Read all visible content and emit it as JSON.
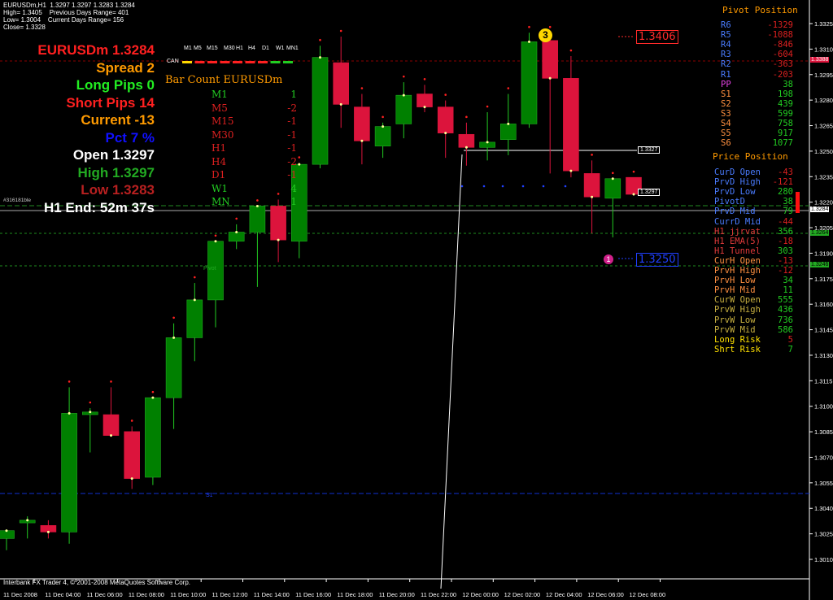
{
  "info": {
    "line1": "EURUSDm,H1  1.3297 1.3297 1.3283 1.3284",
    "line2": "High= 1.3405    Previous Days Range= 401",
    "line3": "Low= 1.3004    Current Days Range= 156",
    "line4": "Close= 1.3328"
  },
  "stats": [
    {
      "text": "EURUSDm 1.3284",
      "color": "#ff2020"
    },
    {
      "text": "Spread 2",
      "color": "#ff9a00"
    },
    {
      "text": "Long Pips 0",
      "color": "#22ee22"
    },
    {
      "text": "Short Pips 14",
      "color": "#ff2020"
    },
    {
      "text": "Current -13",
      "color": "#ff9a00"
    },
    {
      "text": "Pct 7 %",
      "color": "#1010ff"
    },
    {
      "text": "Open 1.3297",
      "color": "#ffffff"
    },
    {
      "text": "High 1.3297",
      "color": "#22aa22"
    },
    {
      "text": "Low 1.3283",
      "color": "#b82020"
    },
    {
      "text": "H1 End: 52m 37s",
      "color": "#ffffff"
    }
  ],
  "tf_header": [
    "M1",
    "M5",
    "M15",
    "M30",
    "H1",
    "H4",
    "D1",
    "W1",
    "MN1"
  ],
  "can_label": "CAN",
  "bar_count": {
    "title": "Bar Count EURUSDm",
    "rows": [
      {
        "tf": "M1",
        "val": "1",
        "color": "#22cc22"
      },
      {
        "tf": "M5",
        "val": "-2",
        "color": "#dd2020"
      },
      {
        "tf": "M15",
        "val": "-1",
        "color": "#dd2020"
      },
      {
        "tf": "M30",
        "val": "-1",
        "color": "#dd2020"
      },
      {
        "tf": "H1",
        "val": "-1",
        "color": "#dd2020"
      },
      {
        "tf": "H4",
        "val": "-2",
        "color": "#dd2020"
      },
      {
        "tf": "D1",
        "val": "-1",
        "color": "#dd2020"
      },
      {
        "tf": "W1",
        "val": "4",
        "color": "#22cc22"
      },
      {
        "tf": "MN",
        "val": "1",
        "color": "#22cc22"
      }
    ]
  },
  "pivot_position": {
    "title": "Pivot Position",
    "rows": [
      {
        "name": "R6",
        "val": "-1329",
        "nc": "#4a7cff",
        "vc": "#dd2020"
      },
      {
        "name": "R5",
        "val": "-1088",
        "nc": "#4a7cff",
        "vc": "#dd2020"
      },
      {
        "name": "R4",
        "val": "-846",
        "nc": "#4a7cff",
        "vc": "#dd2020"
      },
      {
        "name": "R3",
        "val": "-604",
        "nc": "#4a7cff",
        "vc": "#dd2020"
      },
      {
        "name": "R2",
        "val": "-363",
        "nc": "#4a7cff",
        "vc": "#dd2020"
      },
      {
        "name": "R1",
        "val": "-203",
        "nc": "#4a7cff",
        "vc": "#dd2020"
      },
      {
        "name": "PP",
        "val": "38",
        "nc": "#e040e0",
        "vc": "#22cc22"
      },
      {
        "name": "S1",
        "val": "198",
        "nc": "#ff9040",
        "vc": "#22cc22"
      },
      {
        "name": "S2",
        "val": "439",
        "nc": "#ff9040",
        "vc": "#22cc22"
      },
      {
        "name": "S3",
        "val": "599",
        "nc": "#ff9040",
        "vc": "#22cc22"
      },
      {
        "name": "S4",
        "val": "758",
        "nc": "#ff9040",
        "vc": "#22cc22"
      },
      {
        "name": "S5",
        "val": "917",
        "nc": "#ff9040",
        "vc": "#22cc22"
      },
      {
        "name": "S6",
        "val": "1077",
        "nc": "#ff9040",
        "vc": "#22cc22"
      }
    ]
  },
  "price_position": {
    "title": "Price Position",
    "rows": [
      {
        "name": "CurD Open",
        "val": "-43",
        "nc": "#4a7cff",
        "vc": "#dd2020"
      },
      {
        "name": "PrvD High",
        "val": "-121",
        "nc": "#4a7cff",
        "vc": "#dd2020"
      },
      {
        "name": "PrvD Low",
        "val": "280",
        "nc": "#4a7cff",
        "vc": "#22cc22"
      },
      {
        "name": "PivotD",
        "val": "38",
        "nc": "#4a7cff",
        "vc": "#22cc22"
      },
      {
        "name": "PrvD Mid",
        "val": "79",
        "nc": "#4a7cff",
        "vc": "#22cc22"
      },
      {
        "name": "CurrD Mid",
        "val": "-44",
        "nc": "#4a7cff",
        "vc": "#dd2020"
      },
      {
        "name": "H1 jjrvat",
        "val": "356",
        "nc": "#e03a3a",
        "vc": "#22cc22"
      },
      {
        "name": "H1 EMA(5)",
        "val": "-18",
        "nc": "#e03a3a",
        "vc": "#dd2020"
      },
      {
        "name": "H1 Tunnel",
        "val": "303",
        "nc": "#e03a3a",
        "vc": "#22cc22"
      },
      {
        "name": "CurH Open",
        "val": "-13",
        "nc": "#ff9040",
        "vc": "#dd2020"
      },
      {
        "name": "PrvH High",
        "val": "-12",
        "nc": "#ff9040",
        "vc": "#dd2020"
      },
      {
        "name": "PrvH Low",
        "val": "34",
        "nc": "#ff9040",
        "vc": "#22cc22"
      },
      {
        "name": "PrvH Mid",
        "val": "11",
        "nc": "#ff9040",
        "vc": "#22cc22"
      },
      {
        "name": "CurW Open",
        "val": "555",
        "nc": "#c8b040",
        "vc": "#22cc22"
      },
      {
        "name": "PrvW High",
        "val": "436",
        "nc": "#c8b040",
        "vc": "#22cc22"
      },
      {
        "name": "PrvW Low",
        "val": "736",
        "nc": "#c8b040",
        "vc": "#22cc22"
      },
      {
        "name": "PrvW Mid",
        "val": "586",
        "nc": "#c8b040",
        "vc": "#22cc22"
      },
      {
        "name": "Long Risk",
        "val": "5",
        "nc": "#ffe000",
        "vc": "#dd2020"
      },
      {
        "name": "Shrt Risk",
        "val": "7",
        "nc": "#ffe000",
        "vc": "#22cc22"
      }
    ]
  },
  "labels": {
    "level_high": "1.3406",
    "level_low": "1.3250",
    "marker_3": "3",
    "marker_1": "1",
    "tag_3327": "1.3327",
    "tag_3297": "1.3297",
    "pivot_text": "Pivot",
    "s1_text": "S1",
    "footer": "Interbank FX Trader 4, © 2001-2008 MetaQuotes Software Corp.",
    "left_axis_tag": "#316181ble",
    "price_box_current": "1.3284",
    "price_box_r": "1.3388",
    "price_box_g1": "1.3264",
    "price_box_g2": "1.3246"
  },
  "colors": {
    "bull": "#008000",
    "bear": "#dc143c",
    "up_wick": "#22cc22",
    "down_wick": "#dc143c"
  },
  "chart_data": {
    "type": "candlestick",
    "symbol": "EURUSDm",
    "timeframe": "H1",
    "ylim": [
      1.3004,
      1.3336
    ],
    "y_ticks": [
      "1.3325",
      "1.3310",
      "1.3295",
      "1.3280",
      "1.3265",
      "1.3250",
      "1.3235",
      "1.3220",
      "1.3205",
      "1.3190",
      "1.3175",
      "1.3160",
      "1.3145",
      "1.3130",
      "1.3115",
      "1.3100",
      "1.3085",
      "1.3070",
      "1.3055",
      "1.3040",
      "1.3025",
      "1.3010",
      "1.3295",
      "1.3280",
      "1.3265"
    ],
    "y_tick_values": [
      1.3325,
      1.331,
      1.3295,
      1.328,
      1.3265,
      1.325,
      1.3235,
      1.322,
      1.3205,
      1.319,
      1.3175,
      1.316,
      1.3145,
      1.313,
      1.3115,
      1.31,
      1.3085,
      1.307,
      1.3055,
      1.304,
      1.3025,
      1.301
    ],
    "y_tick_labels": [
      "1.3325",
      "1.3310",
      "1.3295",
      "1.3280",
      "1.3265",
      "1.3250",
      "1.3235",
      "1.3220",
      "1.3205",
      "1.3190",
      "1.3175",
      "1.3160",
      "1.3145",
      "1.3130",
      "1.3115",
      "1.3100",
      "1.3085",
      "1.3070",
      "1.3055",
      "1.3040",
      "1.3025",
      "1.3010"
    ],
    "x_ticks": [
      "11 Dec 2008",
      "11 Dec 04:00",
      "11 Dec 06:00",
      "11 Dec 08:00",
      "11 Dec 10:00",
      "11 Dec 12:00",
      "11 Dec 14:00",
      "11 Dec 16:00",
      "11 Dec 18:00",
      "11 Dec 20:00",
      "11 Dec 22:00",
      "12 Dec 00:00",
      "12 Dec 02:00",
      "12 Dec 04:00",
      "12 Dec 06:00",
      "12 Dec 08:00"
    ],
    "candles": [
      {
        "o": 1.302,
        "h": 1.3027,
        "l": 1.3011,
        "c": 1.3026
      },
      {
        "o": 1.3032,
        "h": 1.3037,
        "l": 1.302,
        "c": 1.3034
      },
      {
        "o": 1.303,
        "h": 1.3034,
        "l": 1.302,
        "c": 1.3025
      },
      {
        "o": 1.3025,
        "h": 1.3136,
        "l": 1.3016,
        "c": 1.3116
      },
      {
        "o": 1.3115,
        "h": 1.312,
        "l": 1.3086,
        "c": 1.3117
      },
      {
        "o": 1.3115,
        "h": 1.3136,
        "l": 1.3098,
        "c": 1.3099
      },
      {
        "o": 1.3102,
        "h": 1.3106,
        "l": 1.3058,
        "c": 1.3066
      },
      {
        "o": 1.3067,
        "h": 1.3128,
        "l": 1.3061,
        "c": 1.3128
      },
      {
        "o": 1.3128,
        "h": 1.3185,
        "l": 1.3104,
        "c": 1.3174
      },
      {
        "o": 1.3174,
        "h": 1.3216,
        "l": 1.3156,
        "c": 1.3203
      },
      {
        "o": 1.3203,
        "h": 1.3248,
        "l": 1.3182,
        "c": 1.3248
      },
      {
        "o": 1.3248,
        "h": 1.3261,
        "l": 1.3242,
        "c": 1.3255
      },
      {
        "o": 1.3255,
        "h": 1.3275,
        "l": 1.3213,
        "c": 1.3275
      },
      {
        "o": 1.3275,
        "h": 1.328,
        "l": 1.3232,
        "c": 1.3249
      },
      {
        "o": 1.3248,
        "h": 1.3308,
        "l": 1.3235,
        "c": 1.3307
      },
      {
        "o": 1.3307,
        "h": 1.3398,
        "l": 1.3304,
        "c": 1.3389
      },
      {
        "o": 1.3385,
        "h": 1.3405,
        "l": 1.3335,
        "c": 1.3353
      },
      {
        "o": 1.3351,
        "h": 1.3361,
        "l": 1.3307,
        "c": 1.3325
      },
      {
        "o": 1.3321,
        "h": 1.3339,
        "l": 1.3312,
        "c": 1.3336
      },
      {
        "o": 1.3338,
        "h": 1.337,
        "l": 1.3327,
        "c": 1.336
      },
      {
        "o": 1.3361,
        "h": 1.3368,
        "l": 1.3347,
        "c": 1.3351
      },
      {
        "o": 1.3351,
        "h": 1.3356,
        "l": 1.3312,
        "c": 1.3331
      },
      {
        "o": 1.333,
        "h": 1.3339,
        "l": 1.3306,
        "c": 1.332
      },
      {
        "o": 1.332,
        "h": 1.3347,
        "l": 1.331,
        "c": 1.3324
      },
      {
        "o": 1.3326,
        "h": 1.3361,
        "l": 1.3314,
        "c": 1.3338
      },
      {
        "o": 1.3338,
        "h": 1.3408,
        "l": 1.3335,
        "c": 1.3401
      },
      {
        "o": 1.3402,
        "h": 1.3408,
        "l": 1.33,
        "c": 1.3373
      },
      {
        "o": 1.3373,
        "h": 1.339,
        "l": 1.3297,
        "c": 1.3302
      },
      {
        "o": 1.33,
        "h": 1.331,
        "l": 1.3254,
        "c": 1.3282
      },
      {
        "o": 1.3281,
        "h": 1.3296,
        "l": 1.3251,
        "c": 1.3296
      },
      {
        "o": 1.3297,
        "h": 1.3297,
        "l": 1.3283,
        "c": 1.3284
      }
    ]
  }
}
